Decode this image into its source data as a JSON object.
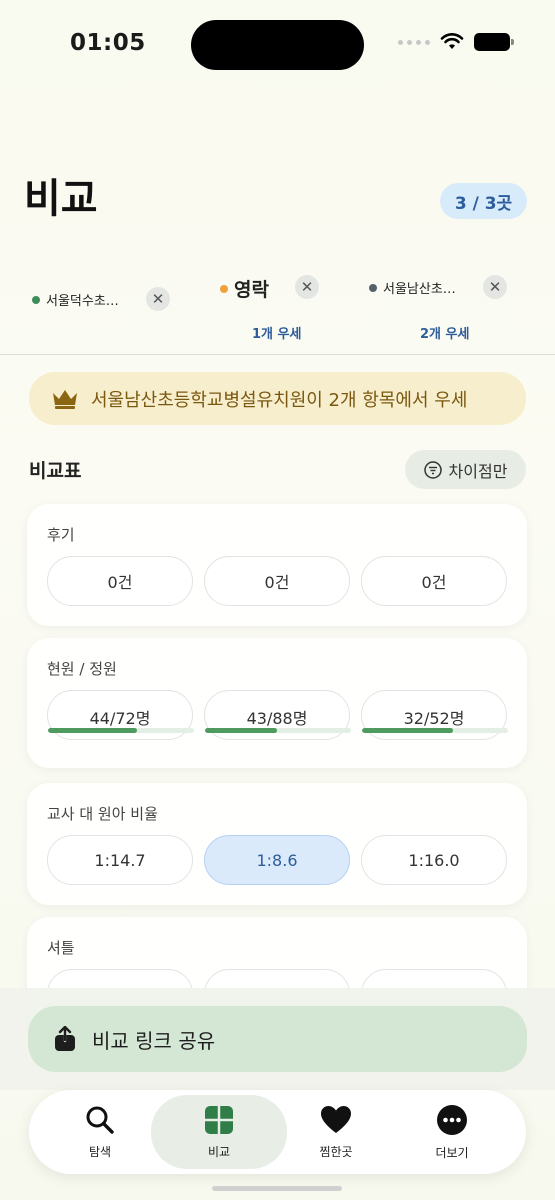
{
  "status_bar": {
    "time": "01:05"
  },
  "header": {
    "title": "비교",
    "count_badge": "3 / 3곳"
  },
  "selected": [
    {
      "name": "서울덕수초…",
      "dot_color": "#3f8d5a",
      "win_label": ""
    },
    {
      "name": "영락",
      "dot_color": "#f2a03d",
      "win_label": "1개 우세"
    },
    {
      "name": "서울남산초…",
      "dot_color": "#55606a",
      "win_label": "2개 우세"
    }
  ],
  "banner": {
    "text": "서울남산초등학교병설유치원이 2개 항목에서 우세",
    "icon": "crown-icon"
  },
  "comparison": {
    "title": "비교표",
    "filter_label": "차이점만",
    "rows": [
      {
        "label": "후기",
        "values": [
          "0건",
          "0건",
          "0건"
        ]
      },
      {
        "label": "현원 / 정원",
        "values": [
          "44/72명",
          "43/88명",
          "32/52명"
        ],
        "progress": [
          0.61,
          0.49,
          0.62
        ]
      },
      {
        "label": "교사 대 원아 비율",
        "values": [
          "1:14.7",
          "1:8.6",
          "1:16.0"
        ],
        "highlight_index": 1
      },
      {
        "label": "셔틀",
        "values": [
          "",
          "",
          ""
        ]
      }
    ]
  },
  "share": {
    "label": "비교 링크 공유"
  },
  "tabs": [
    {
      "label": "탐색",
      "icon": "search-icon"
    },
    {
      "label": "비교",
      "icon": "grid-icon"
    },
    {
      "label": "찜한곳",
      "icon": "heart-icon"
    },
    {
      "label": "더보기",
      "icon": "more-icon"
    }
  ],
  "colors": {
    "accent_green": "#4f9a5e",
    "accent_blue": "#2c5d9c",
    "banner_bg": "#f6eecd"
  }
}
